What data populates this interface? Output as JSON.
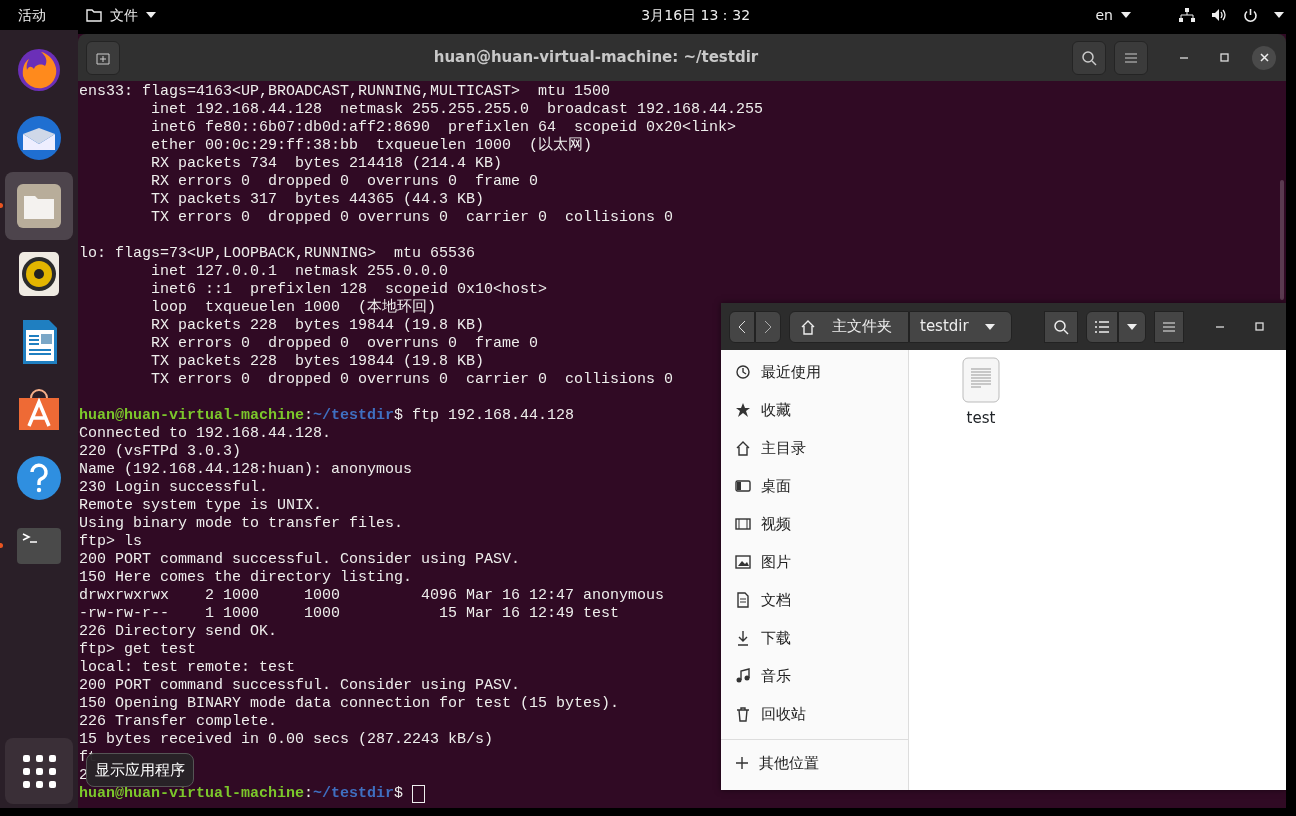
{
  "top_bar": {
    "activities": "活动",
    "app_menu": "文件",
    "clock": "3月16日  13：32",
    "input_source": "en"
  },
  "dock": {
    "items": [
      {
        "kind": "browser",
        "running": false,
        "active": false
      },
      {
        "kind": "mail",
        "running": false,
        "active": false
      },
      {
        "kind": "files",
        "running": true,
        "active": true
      },
      {
        "kind": "music",
        "running": false,
        "active": false
      },
      {
        "kind": "writer",
        "running": false,
        "active": false
      },
      {
        "kind": "store",
        "running": false,
        "active": false
      },
      {
        "kind": "help",
        "running": false,
        "active": false
      },
      {
        "kind": "terminal",
        "running": true,
        "active": false
      }
    ],
    "tooltip": "显示应用程序"
  },
  "terminal": {
    "title": "huan@huan-virtual-machine: ~/testdir",
    "lines": [
      {
        "kind": "output",
        "text": "ens33: flags=4163<UP,BROADCAST,RUNNING,MULTICAST>  mtu 1500"
      },
      {
        "kind": "output",
        "text": "        inet 192.168.44.128  netmask 255.255.255.0  broadcast 192.168.44.255"
      },
      {
        "kind": "output",
        "text": "        inet6 fe80::6b07:db0d:aff2:8690  prefixlen 64  scopeid 0x20<link>"
      },
      {
        "kind": "output",
        "text": "        ether 00:0c:29:ff:38:bb  txqueuelen 1000  (以太网)"
      },
      {
        "kind": "output",
        "text": "        RX packets 734  bytes 214418 (214.4 KB)"
      },
      {
        "kind": "output",
        "text": "        RX errors 0  dropped 0  overruns 0  frame 0"
      },
      {
        "kind": "output",
        "text": "        TX packets 317  bytes 44365 (44.3 KB)"
      },
      {
        "kind": "output",
        "text": "        TX errors 0  dropped 0 overruns 0  carrier 0  collisions 0"
      },
      {
        "kind": "blank"
      },
      {
        "kind": "output",
        "text": "lo: flags=73<UP,LOOPBACK,RUNNING>  mtu 65536"
      },
      {
        "kind": "output",
        "text": "        inet 127.0.0.1  netmask 255.0.0.0"
      },
      {
        "kind": "output",
        "text": "        inet6 ::1  prefixlen 128  scopeid 0x10<host>"
      },
      {
        "kind": "output",
        "text": "        loop  txqueuelen 1000  (本地环回)"
      },
      {
        "kind": "output",
        "text": "        RX packets 228  bytes 19844 (19.8 KB)"
      },
      {
        "kind": "output",
        "text": "        RX errors 0  dropped 0  overruns 0  frame 0"
      },
      {
        "kind": "output",
        "text": "        TX packets 228  bytes 19844 (19.8 KB)"
      },
      {
        "kind": "output",
        "text": "        TX errors 0  dropped 0 overruns 0  carrier 0  collisions 0"
      },
      {
        "kind": "blank"
      },
      {
        "kind": "prompt",
        "user": "huan@huan-virtual-machine",
        "separator": ":",
        "path": "~/testdir",
        "symbol": "$",
        "command": "ftp 192.168.44.128",
        "cursor": false
      },
      {
        "kind": "output",
        "text": "Connected to 192.168.44.128."
      },
      {
        "kind": "output",
        "text": "220 (vsFTPd 3.0.3)"
      },
      {
        "kind": "output",
        "text": "Name (192.168.44.128:huan): anonymous"
      },
      {
        "kind": "output",
        "text": "230 Login successful."
      },
      {
        "kind": "output",
        "text": "Remote system type is UNIX."
      },
      {
        "kind": "output",
        "text": "Using binary mode to transfer files."
      },
      {
        "kind": "output",
        "text": "ftp> ls"
      },
      {
        "kind": "output",
        "text": "200 PORT command successful. Consider using PASV."
      },
      {
        "kind": "output",
        "text": "150 Here comes the directory listing."
      },
      {
        "kind": "output",
        "text": "drwxrwxrwx    2 1000     1000         4096 Mar 16 12:47 anonymous"
      },
      {
        "kind": "output",
        "text": "-rw-rw-r--    1 1000     1000           15 Mar 16 12:49 test"
      },
      {
        "kind": "output",
        "text": "226 Directory send OK."
      },
      {
        "kind": "output",
        "text": "ftp> get test"
      },
      {
        "kind": "output",
        "text": "local: test remote: test"
      },
      {
        "kind": "output",
        "text": "200 PORT command successful. Consider using PASV."
      },
      {
        "kind": "output",
        "text": "150 Opening BINARY mode data connection for test (15 bytes)."
      },
      {
        "kind": "output",
        "text": "226 Transfer complete."
      },
      {
        "kind": "output",
        "text": "15 bytes received in 0.00 secs (287.2243 kB/s)"
      },
      {
        "kind": "output",
        "text": "ft"
      },
      {
        "kind": "output",
        "text": "2"
      },
      {
        "kind": "prompt",
        "user": "huan@huan-virtual-machine",
        "separator": ":",
        "path": "~/testdir",
        "symbol": "$",
        "cursor": true
      }
    ]
  },
  "file_manager": {
    "path": [
      {
        "kind": "home",
        "label": "主文件夹"
      },
      {
        "kind": "folder",
        "label": "testdir"
      }
    ],
    "sidebar": {
      "items": [
        {
          "kind": "recent",
          "label": "最近使用"
        },
        {
          "kind": "starred",
          "label": "收藏"
        },
        {
          "kind": "home",
          "label": "主目录"
        },
        {
          "kind": "desktop",
          "label": "桌面"
        },
        {
          "kind": "videos",
          "label": "视频"
        },
        {
          "kind": "pictures",
          "label": "图片"
        },
        {
          "kind": "documents",
          "label": "文档"
        },
        {
          "kind": "downloads",
          "label": "下载"
        },
        {
          "kind": "music",
          "label": "音乐"
        },
        {
          "kind": "trash",
          "label": "回收站"
        }
      ],
      "other": {
        "label": "其他位置"
      }
    },
    "files": [
      {
        "name": "test"
      }
    ]
  }
}
